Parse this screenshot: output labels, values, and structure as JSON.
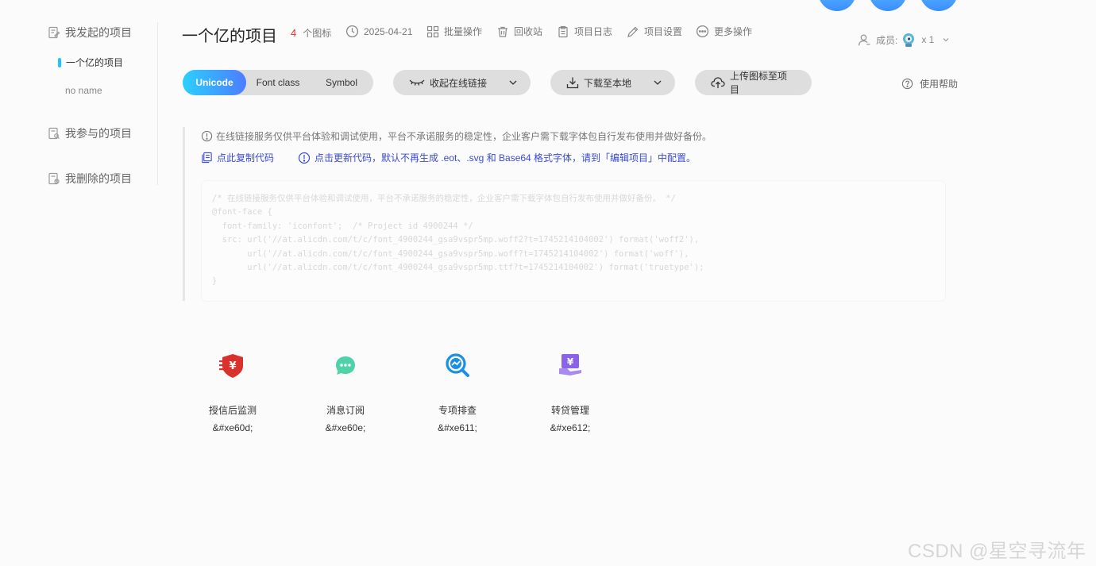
{
  "sidebar": {
    "my_projects": "我发起的项目",
    "project_active": "一个亿的项目",
    "project_other": "no name",
    "joined_projects": "我参与的项目",
    "deleted_projects": "我删除的项目"
  },
  "header": {
    "title": "一个亿的项目",
    "icon_count": "4",
    "icon_count_unit": "个图标",
    "date": "2025-04-21",
    "batch": "批量操作",
    "recycle": "回收站",
    "log": "项目日志",
    "settings": "项目设置",
    "more": "更多操作",
    "members_label": "成员:",
    "members_count": "x 1"
  },
  "toolbar": {
    "tabs": [
      "Unicode",
      "Font class",
      "Symbol"
    ],
    "collapse_link": "收起在线链接",
    "download": "下载至本地",
    "upload": "上传图标至项目",
    "help": "使用帮助"
  },
  "info": {
    "notice": "在线链接服务仅供平台体验和调试使用，平台不承诺服务的稳定性，企业客户需下载字体包自行发布使用并做好备份。",
    "copy_code": "点此复制代码",
    "update_code": "点击更新代码，默认不再生成 .eot、.svg 和 Base64 格式字体，请到「编辑项目」中配置。"
  },
  "code": {
    "lines": [
      "/* 在线链接服务仅供平台体验和调试使用，平台不承诺服务的稳定性，企业客户需下载字体包自行发布使用并做好备份。 */",
      "@font-face {",
      "  font-family: 'iconfont';  /* Project id 4900244 */",
      "  src: url('//at.alicdn.com/t/c/font_4900244_gsa9vspr5mp.woff2?t=1745214104002') format('woff2'),",
      "       url('//at.alicdn.com/t/c/font_4900244_gsa9vspr5mp.woff?t=1745214104002') format('woff'),",
      "       url('//at.alicdn.com/t/c/font_4900244_gsa9vspr5mp.ttf?t=1745214104002') format('truetype');",
      "}"
    ]
  },
  "icons": [
    {
      "name": "授信后监测",
      "code": "&#xe60d;",
      "icon": "shield-yen-icon",
      "color": "#d9312c"
    },
    {
      "name": "消息订阅",
      "code": "&#xe60e;",
      "icon": "chat-bubble-icon",
      "color": "#4fd2a8"
    },
    {
      "name": "专项排查",
      "code": "&#xe611;",
      "icon": "search-chart-icon",
      "color": "#1b8fe6"
    },
    {
      "name": "转贷管理",
      "code": "&#xe612;",
      "icon": "yen-transfer-icon",
      "color": "#8a63e8"
    }
  ],
  "watermark": "CSDN @星空寻流年",
  "colors": {
    "accent_gradient_start": "#2bd0ff",
    "accent_gradient_end": "#4d7cff",
    "count_red": "#e0302b",
    "link_blue": "#3a4bd6"
  }
}
